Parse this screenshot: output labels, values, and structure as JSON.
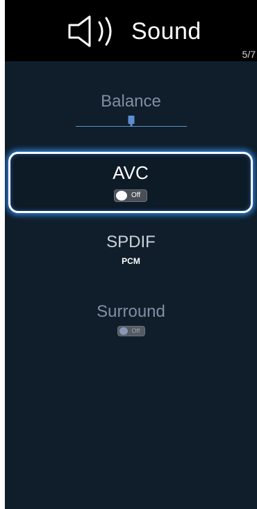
{
  "header": {
    "title": "Sound",
    "icon": "speaker-icon",
    "page_counter": "5/7"
  },
  "menu": {
    "balance": {
      "label": "Balance",
      "slider_level_percent": 50
    },
    "avc": {
      "label": "AVC",
      "toggle_state": "Off",
      "selected": true
    },
    "spdif": {
      "label": "SPDIF",
      "value": "PCM"
    },
    "surround": {
      "label": "Surround",
      "toggle_state": "Off",
      "disabled": true
    }
  },
  "colors": {
    "background": "#0f1e2a",
    "header_background": "#000000",
    "highlight_glow": "#2e7fd8",
    "dim_label": "#7f8fa3",
    "slider_accent": "#5c8dd0"
  }
}
